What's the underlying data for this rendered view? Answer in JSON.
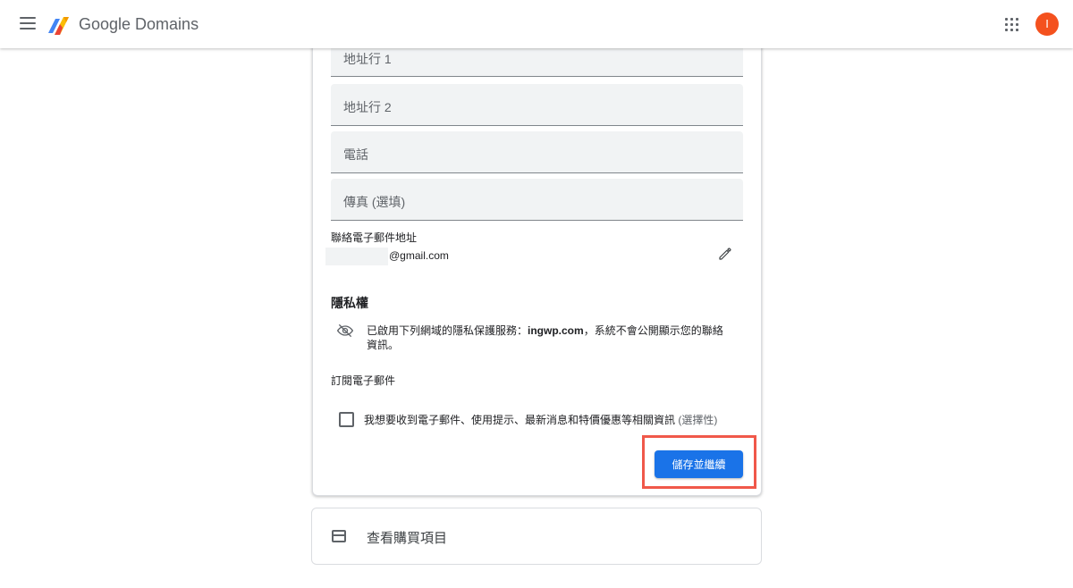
{
  "header": {
    "menu_icon": "hamburger-menu-icon",
    "brand": "Google Domains",
    "apps_icon": "apps-grid-icon",
    "avatar_letter": "I",
    "avatar_color": "#f4511e"
  },
  "form": {
    "fields": [
      {
        "label": "地址行 1"
      },
      {
        "label": "地址行 2"
      },
      {
        "label": "電話"
      },
      {
        "label": "傳真 (選填)"
      }
    ],
    "contact_email_label": "聯絡電子郵件地址",
    "contact_email_suffix": "@gmail.com",
    "edit_icon": "pencil-icon"
  },
  "privacy": {
    "heading": "隱私權",
    "icon": "eye-off-icon",
    "text_prefix": "已啟用下列網域的隱私保護服務：",
    "domain": "ingwp.com",
    "text_suffix": "，系統不會公開顯示您的聯絡資訊。"
  },
  "subscribe": {
    "heading": "訂閱電子郵件",
    "checkbox_label": "我想要收到電子郵件、使用提示、最新消息和特價優惠等相關資訊",
    "optional": "(選擇性)",
    "checked": false
  },
  "actions": {
    "save_label": "儲存並繼續",
    "primary_color": "#1a73e8",
    "highlight_color": "#f0584a"
  },
  "summary": {
    "icon": "credit-card-icon",
    "label": "查看購買項目"
  }
}
